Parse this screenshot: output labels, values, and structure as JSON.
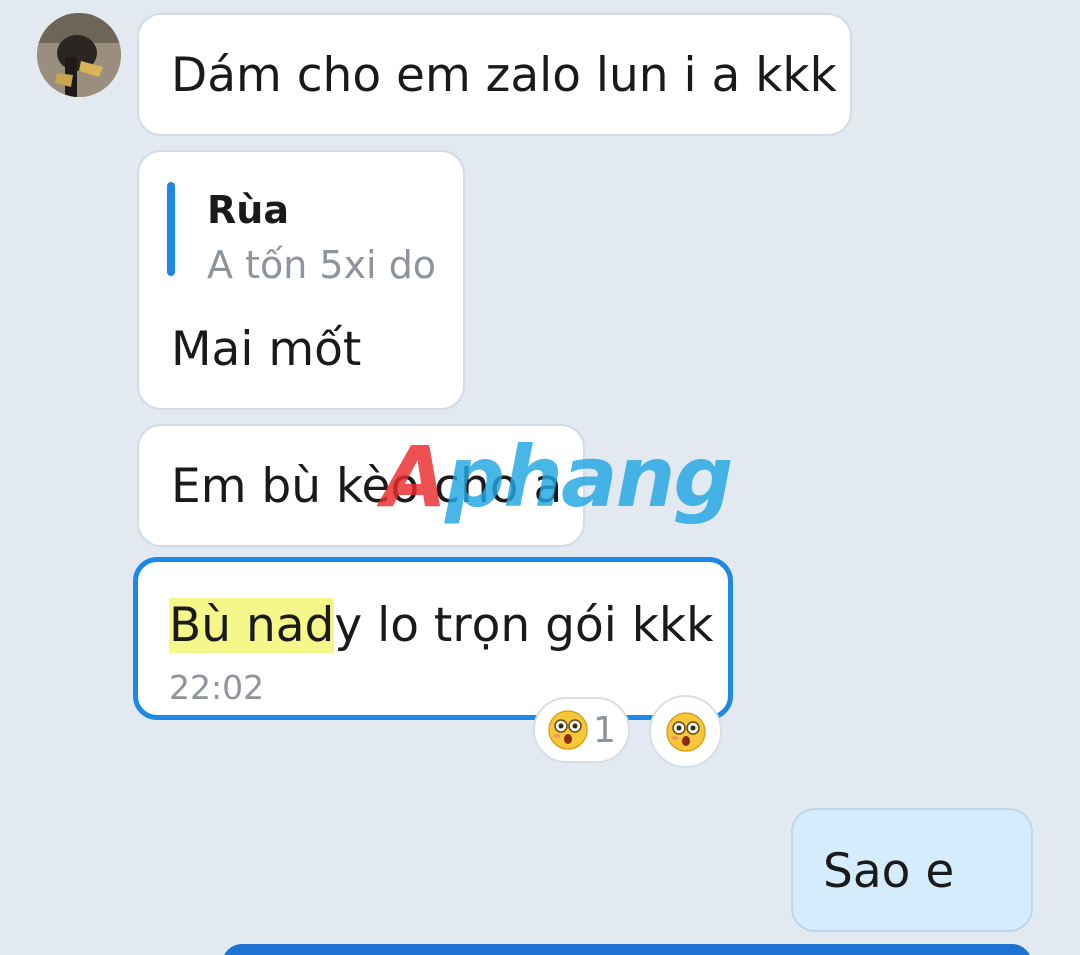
{
  "avatar": {
    "icon": "user-avatar"
  },
  "messages": [
    {
      "text": "Dám cho em zalo lun i a kkk"
    },
    {
      "reply_to": {
        "name": "Rùa",
        "text": "A tốn 5xi do"
      },
      "text": "Mai mốt"
    },
    {
      "text": "Em bù kèo cho a"
    },
    {
      "text_highlighted": "Bù nad",
      "text_rest": "y lo trọn gói kkk",
      "time": "22:02"
    }
  ],
  "reactions": [
    {
      "icon": "astonished-face-icon",
      "count": "1"
    },
    {
      "icon": "astonished-face-icon"
    }
  ],
  "outgoing": {
    "text": "Sao e"
  },
  "watermark": {
    "first": "A",
    "rest": "phang"
  },
  "colors": {
    "background": "#e2e9f1",
    "bubble_in": "#ffffff",
    "bubble_out": "#d5ecfd",
    "selected_border": "#1e88e5",
    "highlight": "#f5f78a",
    "accent": "#1e73d4"
  }
}
